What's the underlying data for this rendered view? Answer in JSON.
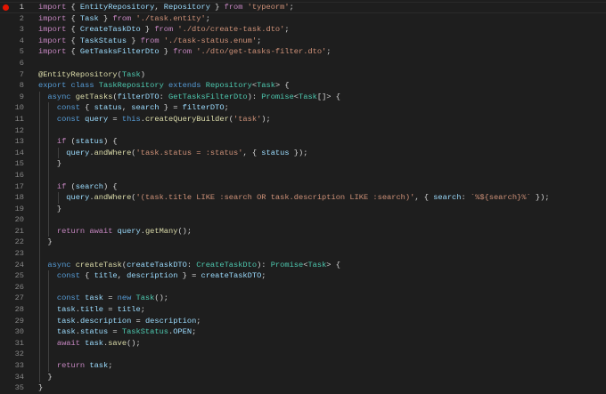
{
  "editor": {
    "breakpoint_line": 1,
    "current_line": 1,
    "lines": [
      {
        "n": "1",
        "i": 0,
        "t": [
          [
            "k",
            "import"
          ],
          [
            "p",
            " { "
          ],
          [
            "v",
            "EntityRepository"
          ],
          [
            "p",
            ", "
          ],
          [
            "v",
            "Repository"
          ],
          [
            "p",
            " } "
          ],
          [
            "k",
            "from"
          ],
          [
            "p",
            " "
          ],
          [
            "s",
            "'typeorm'"
          ],
          [
            "p",
            ";"
          ]
        ]
      },
      {
        "n": "2",
        "i": 0,
        "t": [
          [
            "k",
            "import"
          ],
          [
            "p",
            " { "
          ],
          [
            "v",
            "Task"
          ],
          [
            "p",
            " } "
          ],
          [
            "k",
            "from"
          ],
          [
            "p",
            " "
          ],
          [
            "s",
            "'./task.entity'"
          ],
          [
            "p",
            ";"
          ]
        ]
      },
      {
        "n": "3",
        "i": 0,
        "t": [
          [
            "k",
            "import"
          ],
          [
            "p",
            " { "
          ],
          [
            "v",
            "CreateTaskDto"
          ],
          [
            "p",
            " } "
          ],
          [
            "k",
            "from"
          ],
          [
            "p",
            " "
          ],
          [
            "s",
            "'./dto/create-task.dto'"
          ],
          [
            "p",
            ";"
          ]
        ]
      },
      {
        "n": "4",
        "i": 0,
        "t": [
          [
            "k",
            "import"
          ],
          [
            "p",
            " { "
          ],
          [
            "v",
            "TaskStatus"
          ],
          [
            "p",
            " } "
          ],
          [
            "k",
            "from"
          ],
          [
            "p",
            " "
          ],
          [
            "s",
            "'./task-status.enum'"
          ],
          [
            "p",
            ";"
          ]
        ]
      },
      {
        "n": "5",
        "i": 0,
        "t": [
          [
            "k",
            "import"
          ],
          [
            "p",
            " { "
          ],
          [
            "v",
            "GetTasksFilterDto"
          ],
          [
            "p",
            " } "
          ],
          [
            "k",
            "from"
          ],
          [
            "p",
            " "
          ],
          [
            "s",
            "'./dto/get-tasks-filter.dto'"
          ],
          [
            "p",
            ";"
          ]
        ]
      },
      {
        "n": "6",
        "i": 0,
        "t": []
      },
      {
        "n": "7",
        "i": 0,
        "t": [
          [
            "f",
            "@EntityRepository"
          ],
          [
            "p",
            "("
          ],
          [
            "t",
            "Task"
          ],
          [
            "p",
            ")"
          ]
        ]
      },
      {
        "n": "8",
        "i": 0,
        "t": [
          [
            "b",
            "export"
          ],
          [
            "p",
            " "
          ],
          [
            "b",
            "class"
          ],
          [
            "p",
            " "
          ],
          [
            "t",
            "TaskRepository"
          ],
          [
            "p",
            " "
          ],
          [
            "b",
            "extends"
          ],
          [
            "p",
            " "
          ],
          [
            "t",
            "Repository"
          ],
          [
            "p",
            "<"
          ],
          [
            "t",
            "Task"
          ],
          [
            "p",
            "> {"
          ]
        ]
      },
      {
        "n": "9",
        "i": 1,
        "t": [
          [
            "b",
            "  async"
          ],
          [
            "p",
            " "
          ],
          [
            "f",
            "getTasks"
          ],
          [
            "p",
            "("
          ],
          [
            "v",
            "filterDTO"
          ],
          [
            "p",
            ": "
          ],
          [
            "t",
            "GetTasksFilterDto"
          ],
          [
            "p",
            "): "
          ],
          [
            "t",
            "Promise"
          ],
          [
            "p",
            "<"
          ],
          [
            "t",
            "Task"
          ],
          [
            "p",
            "[]> {"
          ]
        ]
      },
      {
        "n": "10",
        "i": 2,
        "t": [
          [
            "b",
            "    const"
          ],
          [
            "p",
            " { "
          ],
          [
            "v",
            "status"
          ],
          [
            "p",
            ", "
          ],
          [
            "v",
            "search"
          ],
          [
            "p",
            " } = "
          ],
          [
            "v",
            "filterDTO"
          ],
          [
            "p",
            ";"
          ]
        ]
      },
      {
        "n": "11",
        "i": 2,
        "t": [
          [
            "b",
            "    const"
          ],
          [
            "p",
            " "
          ],
          [
            "v",
            "query"
          ],
          [
            "p",
            " = "
          ],
          [
            "b",
            "this"
          ],
          [
            "p",
            "."
          ],
          [
            "f",
            "createQueryBuilder"
          ],
          [
            "p",
            "("
          ],
          [
            "s",
            "'task'"
          ],
          [
            "p",
            ");"
          ]
        ]
      },
      {
        "n": "12",
        "i": 2,
        "t": []
      },
      {
        "n": "13",
        "i": 2,
        "t": [
          [
            "k",
            "    if"
          ],
          [
            "p",
            " ("
          ],
          [
            "v",
            "status"
          ],
          [
            "p",
            ") {"
          ]
        ]
      },
      {
        "n": "14",
        "i": 3,
        "t": [
          [
            "v",
            "      query"
          ],
          [
            "p",
            "."
          ],
          [
            "f",
            "andWhere"
          ],
          [
            "p",
            "("
          ],
          [
            "s",
            "'task.status = :status'"
          ],
          [
            "p",
            ", { "
          ],
          [
            "v",
            "status"
          ],
          [
            "p",
            " });"
          ]
        ]
      },
      {
        "n": "15",
        "i": 2,
        "t": [
          [
            "p",
            "    }"
          ]
        ]
      },
      {
        "n": "16",
        "i": 2,
        "t": []
      },
      {
        "n": "17",
        "i": 2,
        "t": [
          [
            "k",
            "    if"
          ],
          [
            "p",
            " ("
          ],
          [
            "v",
            "search"
          ],
          [
            "p",
            ") {"
          ]
        ]
      },
      {
        "n": "18",
        "i": 3,
        "t": [
          [
            "v",
            "      query"
          ],
          [
            "p",
            "."
          ],
          [
            "f",
            "andWhere"
          ],
          [
            "p",
            "("
          ],
          [
            "s",
            "'(task.title LIKE :search OR task.description LIKE :search)'"
          ],
          [
            "p",
            ", { "
          ],
          [
            "v",
            "search"
          ],
          [
            "p",
            ": "
          ],
          [
            "s",
            "`%${search}%`"
          ],
          [
            "p",
            " });"
          ]
        ]
      },
      {
        "n": "19",
        "i": 2,
        "t": [
          [
            "p",
            "    }"
          ]
        ]
      },
      {
        "n": "20",
        "i": 2,
        "t": []
      },
      {
        "n": "21",
        "i": 2,
        "t": [
          [
            "k",
            "    return"
          ],
          [
            "p",
            " "
          ],
          [
            "k",
            "await"
          ],
          [
            "p",
            " "
          ],
          [
            "v",
            "query"
          ],
          [
            "p",
            "."
          ],
          [
            "f",
            "getMany"
          ],
          [
            "p",
            "();"
          ]
        ]
      },
      {
        "n": "22",
        "i": 1,
        "t": [
          [
            "p",
            "  }"
          ]
        ]
      },
      {
        "n": "23",
        "i": 1,
        "t": []
      },
      {
        "n": "24",
        "i": 1,
        "t": [
          [
            "b",
            "  async"
          ],
          [
            "p",
            " "
          ],
          [
            "f",
            "createTask"
          ],
          [
            "p",
            "("
          ],
          [
            "v",
            "createTaskDTO"
          ],
          [
            "p",
            ": "
          ],
          [
            "t",
            "CreateTaskDto"
          ],
          [
            "p",
            "): "
          ],
          [
            "t",
            "Promise"
          ],
          [
            "p",
            "<"
          ],
          [
            "t",
            "Task"
          ],
          [
            "p",
            "> {"
          ]
        ]
      },
      {
        "n": "25",
        "i": 2,
        "t": [
          [
            "b",
            "    const"
          ],
          [
            "p",
            " { "
          ],
          [
            "v",
            "title"
          ],
          [
            "p",
            ", "
          ],
          [
            "v",
            "description"
          ],
          [
            "p",
            " } = "
          ],
          [
            "v",
            "createTaskDTO"
          ],
          [
            "p",
            ";"
          ]
        ]
      },
      {
        "n": "26",
        "i": 2,
        "t": []
      },
      {
        "n": "27",
        "i": 2,
        "t": [
          [
            "b",
            "    const"
          ],
          [
            "p",
            " "
          ],
          [
            "v",
            "task"
          ],
          [
            "p",
            " = "
          ],
          [
            "b",
            "new"
          ],
          [
            "p",
            " "
          ],
          [
            "t",
            "Task"
          ],
          [
            "p",
            "();"
          ]
        ]
      },
      {
        "n": "28",
        "i": 2,
        "t": [
          [
            "v",
            "    task"
          ],
          [
            "p",
            "."
          ],
          [
            "v",
            "title"
          ],
          [
            "p",
            " = "
          ],
          [
            "v",
            "title"
          ],
          [
            "p",
            ";"
          ]
        ]
      },
      {
        "n": "29",
        "i": 2,
        "t": [
          [
            "v",
            "    task"
          ],
          [
            "p",
            "."
          ],
          [
            "v",
            "description"
          ],
          [
            "p",
            " = "
          ],
          [
            "v",
            "description"
          ],
          [
            "p",
            ";"
          ]
        ]
      },
      {
        "n": "30",
        "i": 2,
        "t": [
          [
            "v",
            "    task"
          ],
          [
            "p",
            "."
          ],
          [
            "v",
            "status"
          ],
          [
            "p",
            " = "
          ],
          [
            "t",
            "TaskStatus"
          ],
          [
            "p",
            "."
          ],
          [
            "v",
            "OPEN"
          ],
          [
            "p",
            ";"
          ]
        ]
      },
      {
        "n": "31",
        "i": 2,
        "t": [
          [
            "k",
            "    await"
          ],
          [
            "p",
            " "
          ],
          [
            "v",
            "task"
          ],
          [
            "p",
            "."
          ],
          [
            "f",
            "save"
          ],
          [
            "p",
            "();"
          ]
        ]
      },
      {
        "n": "32",
        "i": 2,
        "t": []
      },
      {
        "n": "33",
        "i": 2,
        "t": [
          [
            "k",
            "    return"
          ],
          [
            "p",
            " "
          ],
          [
            "v",
            "task"
          ],
          [
            "p",
            ";"
          ]
        ]
      },
      {
        "n": "34",
        "i": 1,
        "t": [
          [
            "p",
            "  }"
          ]
        ]
      },
      {
        "n": "35",
        "i": 0,
        "t": [
          [
            "p",
            "}"
          ]
        ]
      }
    ]
  }
}
